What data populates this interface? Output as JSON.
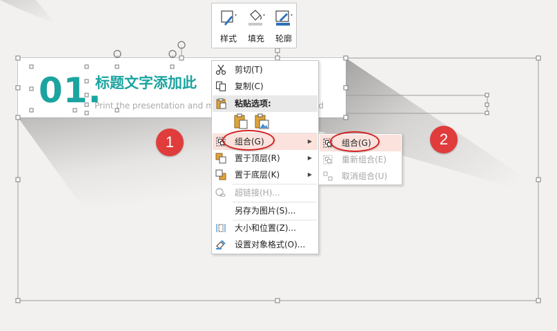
{
  "slide": {
    "number": "01.",
    "title": "标题文字添加此",
    "subtitle": "Print the presentation and ma",
    "subtitle_tail": "ld"
  },
  "badges": {
    "first": "1",
    "second": "2"
  },
  "mini_toolbar": {
    "style_label": "样式",
    "fill_label": "填充",
    "outline_label": "轮廓"
  },
  "context_menu": {
    "cut": "剪切(T)",
    "copy": "复制(C)",
    "paste_options": "粘贴选项:",
    "group": "组合(G)",
    "bring_to_front": "置于顶层(R)",
    "send_to_back": "置于底层(K)",
    "hyperlink": "超链接(H)...",
    "save_as_picture": "另存为图片(S)...",
    "size_position": "大小和位置(Z)...",
    "format_object": "设置对象格式(O)..."
  },
  "submenu": {
    "group": "组合(G)",
    "regroup": "重新组合(E)",
    "ungroup": "取消组合(U)"
  },
  "colors": {
    "accent_teal": "#1ba4a0",
    "badge_red": "#e03c3c",
    "highlight": "#fbe2dc"
  }
}
